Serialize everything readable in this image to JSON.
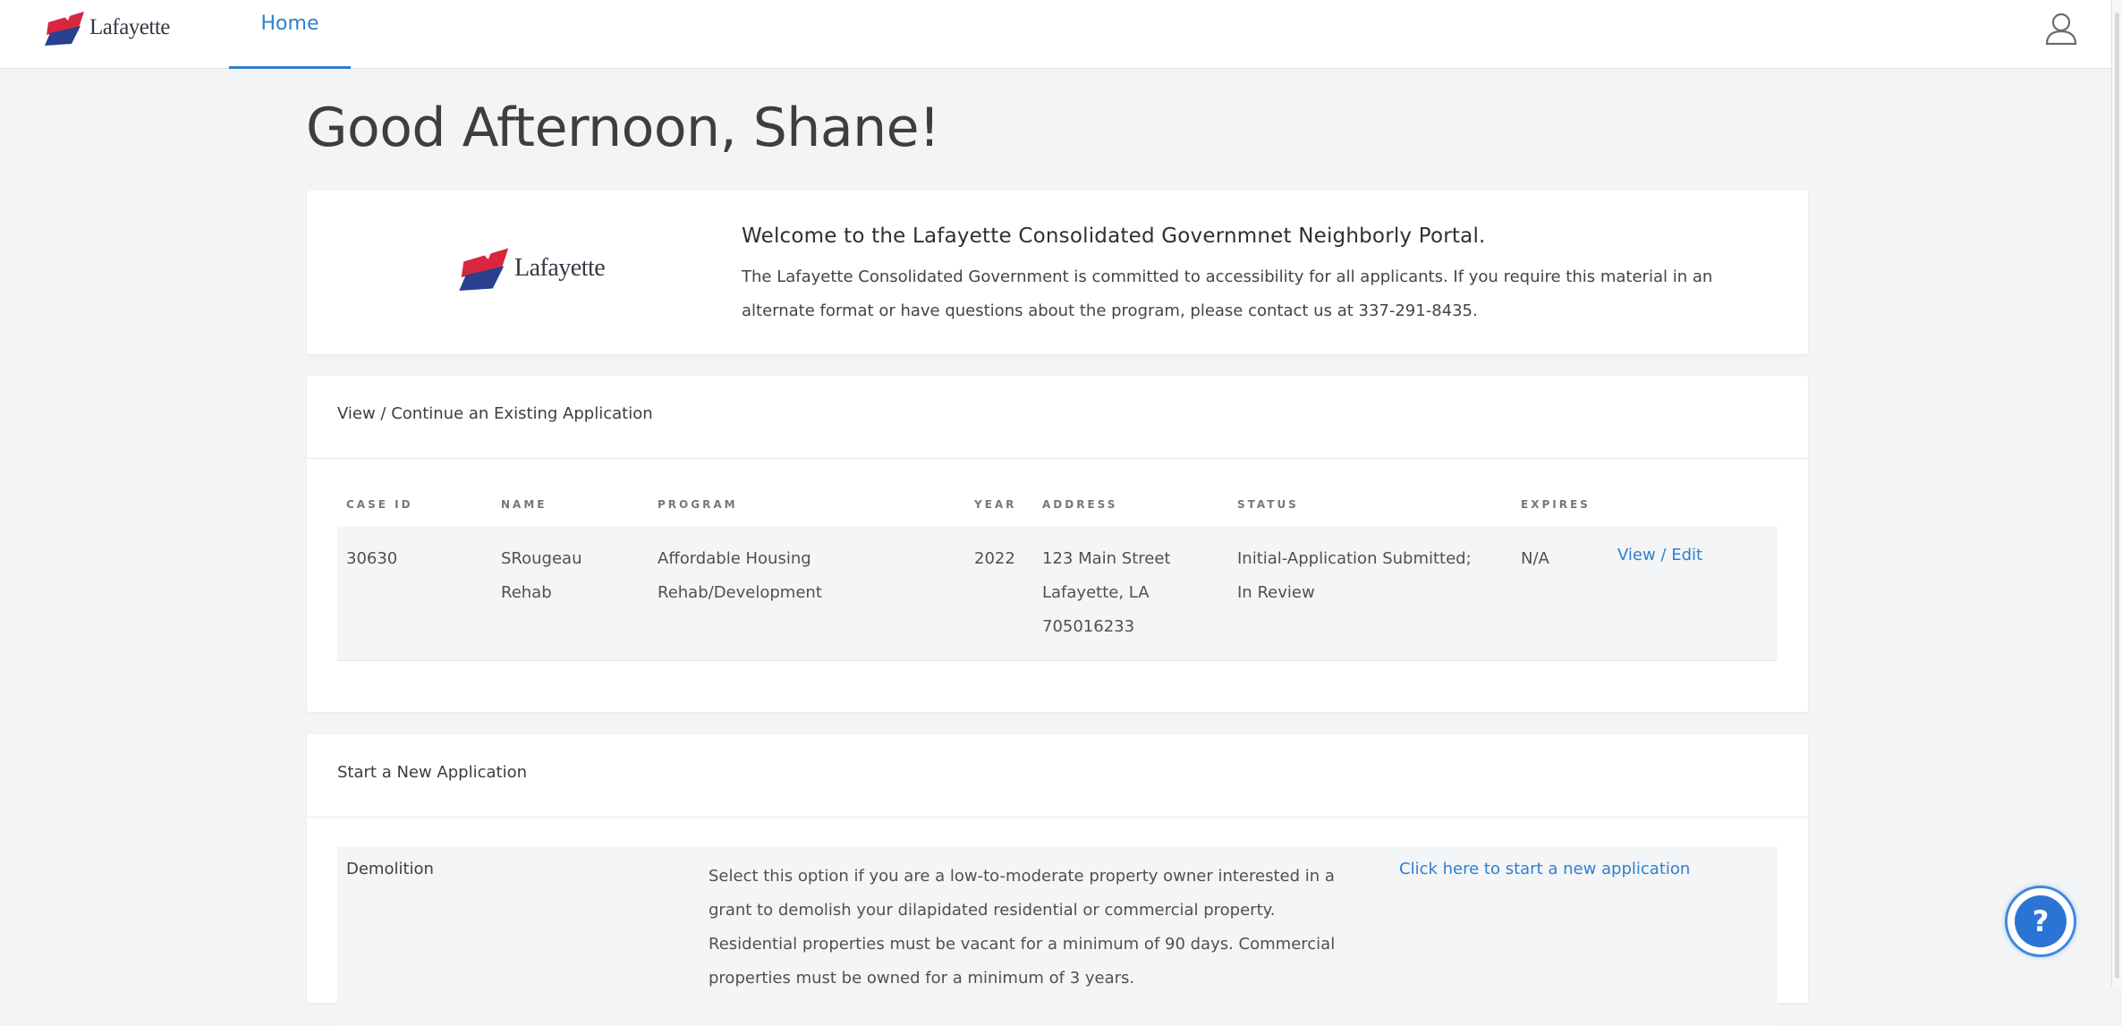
{
  "header": {
    "logo_text": "Lafayette",
    "nav_home": "Home"
  },
  "greeting": "Good Afternoon, Shane!",
  "welcome": {
    "logo_text": "Lafayette",
    "title": "Welcome to the Lafayette Consolidated Governmnet Neighborly Portal.",
    "body": "The Lafayette Consolidated Government is committed to accessibility for all applicants. If you require this material in an alternate format or have questions about the program, please contact us at 337-291-8435."
  },
  "existing": {
    "header": "View / Continue an Existing Application",
    "columns": [
      "CASE ID",
      "NAME",
      "PROGRAM",
      "YEAR",
      "ADDRESS",
      "STATUS",
      "EXPIRES"
    ],
    "rows": [
      {
        "case_id": "30630",
        "name_line1": "SRougeau",
        "name_line2": "Rehab",
        "program_line1": "Affordable Housing",
        "program_line2": "Rehab/Development",
        "year": "2022",
        "address_line1": "123 Main Street",
        "address_line2": "Lafayette, LA",
        "address_line3": "705016233",
        "status_line1": "Initial-Application Submitted;",
        "status_line2": "In Review",
        "expires": "N/A",
        "action": "View / Edit"
      }
    ]
  },
  "new_application": {
    "header": "Start a New Application",
    "items": [
      {
        "name": "Demolition",
        "description": "Select this option if you are a low-to-moderate property owner interested in a grant to demolish your dilapidated residential or commercial property. Residential properties must be vacant for a minimum of 90 days. Commercial properties must be owned for a minimum of 3 years.",
        "action": "Click here to start a new application"
      }
    ]
  },
  "help_button": "?",
  "colors": {
    "accent": "#2e7fd0",
    "logo_red": "#d7263d",
    "logo_blue": "#2a3f8f",
    "background": "#f3f4f6"
  },
  "icons": {
    "user": "user-icon",
    "help": "help-icon"
  }
}
